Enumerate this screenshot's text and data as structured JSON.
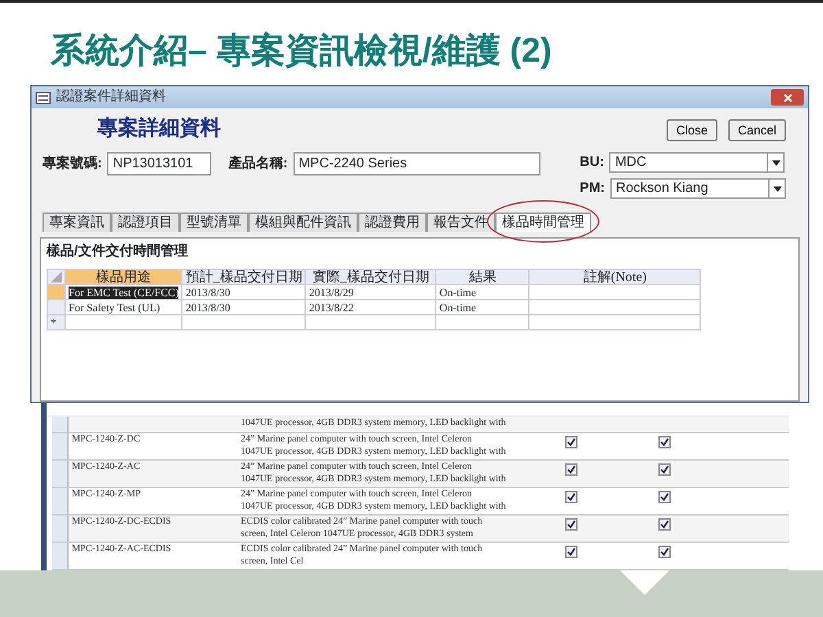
{
  "slide": {
    "title": "系統介紹– 專案資訊檢視/維護 (2)"
  },
  "window": {
    "title": "認證案件詳細資料",
    "heading": "專案詳細資料",
    "buttons": [
      "Close",
      "Cancel"
    ],
    "fields": [
      {
        "label": "專案號碼:",
        "value": "NP13013101"
      },
      {
        "label": "產品名稱:",
        "value": "MPC-2240 Series"
      }
    ],
    "dropdowns": [
      {
        "label": "BU:",
        "value": "MDC"
      },
      {
        "label": "PM:",
        "value": "Rockson  Kiang"
      }
    ],
    "tabs": [
      {
        "label": "專案資訊",
        "selected": false,
        "circled": false
      },
      {
        "label": "認證項目",
        "selected": false,
        "circled": false
      },
      {
        "label": "型號清單",
        "selected": false,
        "circled": false
      },
      {
        "label": "模組與配件資訊",
        "selected": false,
        "circled": false
      },
      {
        "label": "認證費用",
        "selected": false,
        "circled": false
      },
      {
        "label": "報告文件",
        "selected": false,
        "circled": false
      },
      {
        "label": "樣品時間管理",
        "selected": true,
        "circled": true
      }
    ],
    "panel_title": "樣品/文件交付時間管理",
    "grid": {
      "columns": [
        "樣品用途",
        "預計_樣品交付日期",
        "實際_樣品交付日期",
        "結果",
        "註解(Note)"
      ],
      "rows": [
        {
          "cells": [
            "For EMC Test (CE/FCC)",
            "2013/8/30",
            "2013/8/29",
            "On-time",
            ""
          ],
          "selected": true
        },
        {
          "cells": [
            "For Safety Test (UL)",
            "2013/8/30",
            "2013/8/22",
            "On-time",
            ""
          ],
          "selected": false
        }
      ],
      "new_row_marker": "*"
    }
  },
  "model_table": {
    "rows": [
      {
        "model": "",
        "description": [
          "1047UE processor, 4GB DDR3 system memory, LED backlight with"
        ]
      },
      {
        "model": "MPC-1240-Z-DC",
        "description": [
          "24” Marine panel computer with touch screen, Intel Celeron",
          "1047UE processor, 4GB DDR3 system memory, LED backlight with"
        ],
        "checks": [
          true,
          true
        ]
      },
      {
        "model": "MPC-1240-Z-AC",
        "description": [
          "24” Marine panel computer with touch screen, Intel Celeron",
          "1047UE processor, 4GB DDR3 system memory, LED backlight with"
        ],
        "checks": [
          true,
          true
        ]
      },
      {
        "model": "MPC-1240-Z-MP",
        "description": [
          "24” Marine panel computer with touch screen, Intel Celeron",
          "1047UE processor, 4GB DDR3 system memory, LED backlight with"
        ],
        "checks": [
          true,
          true
        ]
      },
      {
        "model": "MPC-1240-Z-DC-ECDIS",
        "description": [
          "ECDIS color calibrated 24” Marine panel computer with touch",
          "screen, Intel Celeron 1047UE processor, 4GB DDR3 system"
        ],
        "checks": [
          true,
          true
        ]
      },
      {
        "model": "MPC-1240-Z-AC-ECDIS",
        "description": [
          "ECDIS color calibrated 24” Marine panel computer with touch",
          "screen, Intel Cel"
        ],
        "checks": [
          true,
          true
        ]
      }
    ]
  }
}
